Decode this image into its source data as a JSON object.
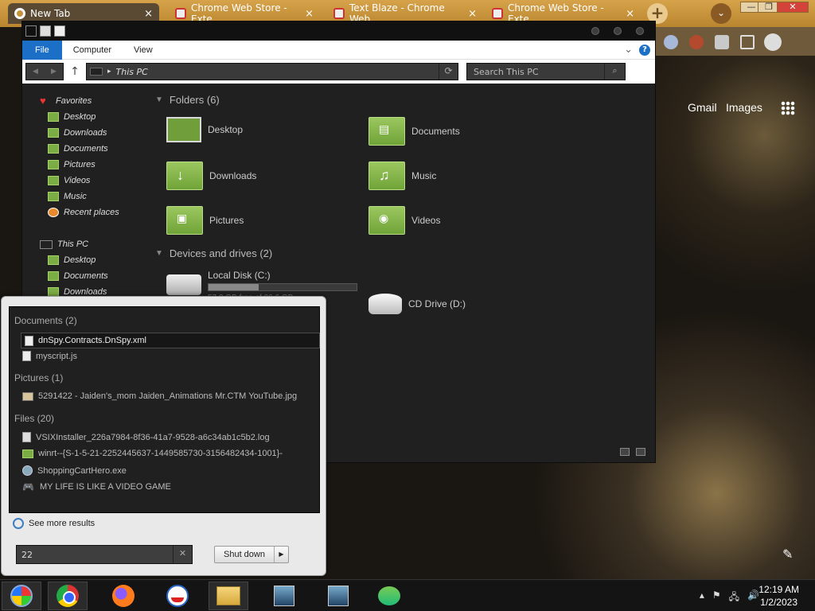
{
  "chrome": {
    "tabs": [
      {
        "title": "New Tab",
        "close": "×"
      },
      {
        "title": "Chrome Web Store - Exte",
        "close": "×"
      },
      {
        "title": "Text Blaze - Chrome Web",
        "close": "×"
      },
      {
        "title": "Chrome Web Store - Exte",
        "close": "×"
      }
    ],
    "new_tab": "+",
    "tab_menu": "⌄",
    "window_controls": [
      "—",
      "❐",
      "✕"
    ],
    "links": {
      "gmail": "Gmail",
      "images": "Images"
    },
    "edit_icon": "✎"
  },
  "explorer": {
    "ribbon_tabs": [
      "File",
      "Computer",
      "View"
    ],
    "ribbon_expand": "⌄",
    "help": "?",
    "nav": {
      "back": "◀",
      "forward": "▶",
      "up": "↑"
    },
    "address": "This PC",
    "address_arrow": "▸",
    "refresh": "⟳",
    "search_placeholder": "Search This PC",
    "search_icon": "⌕",
    "nav_pane": {
      "favorites": "Favorites",
      "favorites_items": [
        "Desktop",
        "Downloads",
        "Documents",
        "Pictures",
        "Videos",
        "Music",
        "Recent places"
      ],
      "this_pc": "This PC",
      "this_pc_items": [
        "Desktop",
        "Documents",
        "Downloads"
      ]
    },
    "folders_header": "Folders (6)",
    "folders": [
      "Desktop",
      "Documents",
      "Downloads",
      "Music",
      "Pictures",
      "Videos"
    ],
    "drives_header": "Devices and drives (2)",
    "drives": [
      {
        "name": "Local Disk (C:)",
        "free": "57.2 GB free of 86.6 GB",
        "used_fraction": 0.34
      },
      {
        "name": "CD Drive (D:)"
      }
    ]
  },
  "start_menu": {
    "documents_header": "Documents (2)",
    "documents": [
      "dnSpy.Contracts.DnSpy.xml",
      "myscript.js"
    ],
    "pictures_header": "Pictures (1)",
    "pictures": [
      "5291422 - Jaiden's_mom Jaiden_Animations Mr.CTM YouTube.jpg"
    ],
    "files_header": "Files (20)",
    "files": [
      "VSIXInstaller_226a7984-8f36-41a7-9528-a6c34ab1c5b2.log",
      "winrt--{S-1-5-21-2252445637-1449585730-3156482434-1001}-",
      "ShoppingCartHero.exe",
      "MY LIFE IS LIKE A VIDEO GAME"
    ],
    "see_more": "See more results",
    "search_value": "22",
    "clear": "✕",
    "shutdown": "Shut down",
    "shutdown_arrow": "▶"
  },
  "taskbar": {
    "tray_icons": [
      "▴",
      "⚑",
      "🖧",
      "🔊"
    ],
    "time": "12:19 AM",
    "date": "1/2/2023"
  }
}
